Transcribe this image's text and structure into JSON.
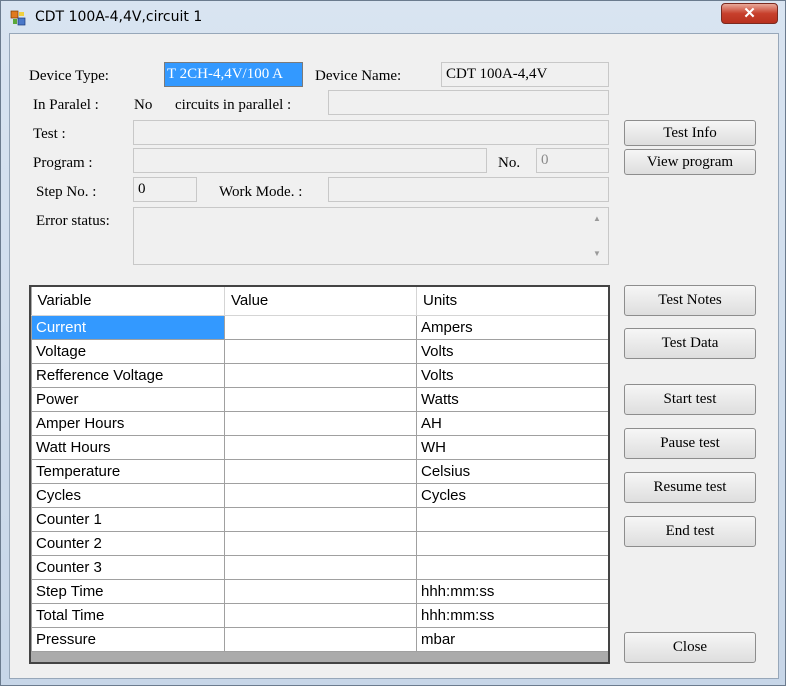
{
  "window": {
    "title": "CDT 100A-4,4V,circuit 1",
    "close_glyph": "✕"
  },
  "form": {
    "device_type_label": "Device Type:",
    "device_type_value": "T  2CH-4,4V/100 A",
    "device_name_label": "Device Name:",
    "device_name_value": "CDT 100A-4,4V",
    "in_paralel_label": "In Paralel :",
    "in_paralel_value": "No",
    "circuits_parallel_label": "circuits in parallel :",
    "circuits_parallel_value": "",
    "test_label": "Test :",
    "test_value": "",
    "program_label": "Program :",
    "program_value": "",
    "no_label": "No.",
    "no_value": "0",
    "step_no_label": "Step No. :",
    "step_no_value": "0",
    "work_mode_label": "Work Mode. :",
    "work_mode_value": "",
    "error_status_label": "Error status:",
    "error_status_value": ""
  },
  "buttons": {
    "test_info": "Test Info",
    "view_program": "View program",
    "test_notes": "Test Notes",
    "test_data": "Test Data",
    "start_test": "Start test",
    "pause_test": "Pause test",
    "resume_test": "Resume test",
    "end_test": "End test",
    "close": "Close"
  },
  "grid": {
    "columns": [
      "Variable",
      "Value",
      "Units"
    ],
    "rows": [
      {
        "variable": "Current",
        "value": "",
        "units": "Ampers"
      },
      {
        "variable": "Voltage",
        "value": "",
        "units": "Volts"
      },
      {
        "variable": "Refference Voltage",
        "value": "",
        "units": "Volts"
      },
      {
        "variable": "Power",
        "value": "",
        "units": "Watts"
      },
      {
        "variable": "Amper Hours",
        "value": "",
        "units": "AH"
      },
      {
        "variable": "Watt Hours",
        "value": "",
        "units": "WH"
      },
      {
        "variable": "Temperature",
        "value": "",
        "units": "Celsius"
      },
      {
        "variable": "Cycles",
        "value": "",
        "units": "Cycles"
      },
      {
        "variable": "Counter 1",
        "value": "",
        "units": ""
      },
      {
        "variable": "Counter 2",
        "value": "",
        "units": ""
      },
      {
        "variable": "Counter 3",
        "value": "",
        "units": ""
      },
      {
        "variable": "Step Time",
        "value": "",
        "units": "hhh:mm:ss"
      },
      {
        "variable": "Total Time",
        "value": "",
        "units": "hhh:mm:ss"
      },
      {
        "variable": "Pressure",
        "value": "",
        "units": "mbar"
      }
    ]
  }
}
